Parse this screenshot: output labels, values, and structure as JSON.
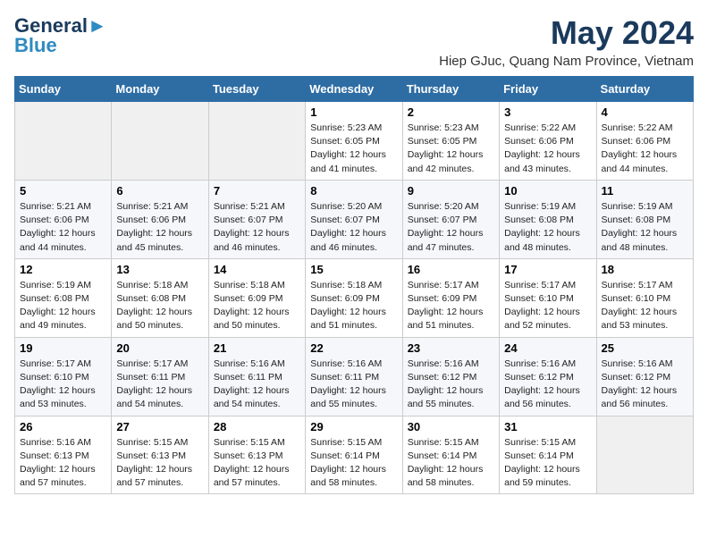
{
  "logo": {
    "general": "General",
    "blue": "Blue"
  },
  "header": {
    "month_year": "May 2024",
    "location": "Hiep GJuc, Quang Nam Province, Vietnam"
  },
  "days_of_week": [
    "Sunday",
    "Monday",
    "Tuesday",
    "Wednesday",
    "Thursday",
    "Friday",
    "Saturday"
  ],
  "weeks": [
    {
      "days": [
        {
          "num": "",
          "info": ""
        },
        {
          "num": "",
          "info": ""
        },
        {
          "num": "",
          "info": ""
        },
        {
          "num": "1",
          "info": "Sunrise: 5:23 AM\nSunset: 6:05 PM\nDaylight: 12 hours\nand 41 minutes."
        },
        {
          "num": "2",
          "info": "Sunrise: 5:23 AM\nSunset: 6:05 PM\nDaylight: 12 hours\nand 42 minutes."
        },
        {
          "num": "3",
          "info": "Sunrise: 5:22 AM\nSunset: 6:06 PM\nDaylight: 12 hours\nand 43 minutes."
        },
        {
          "num": "4",
          "info": "Sunrise: 5:22 AM\nSunset: 6:06 PM\nDaylight: 12 hours\nand 44 minutes."
        }
      ]
    },
    {
      "days": [
        {
          "num": "5",
          "info": "Sunrise: 5:21 AM\nSunset: 6:06 PM\nDaylight: 12 hours\nand 44 minutes."
        },
        {
          "num": "6",
          "info": "Sunrise: 5:21 AM\nSunset: 6:06 PM\nDaylight: 12 hours\nand 45 minutes."
        },
        {
          "num": "7",
          "info": "Sunrise: 5:21 AM\nSunset: 6:07 PM\nDaylight: 12 hours\nand 46 minutes."
        },
        {
          "num": "8",
          "info": "Sunrise: 5:20 AM\nSunset: 6:07 PM\nDaylight: 12 hours\nand 46 minutes."
        },
        {
          "num": "9",
          "info": "Sunrise: 5:20 AM\nSunset: 6:07 PM\nDaylight: 12 hours\nand 47 minutes."
        },
        {
          "num": "10",
          "info": "Sunrise: 5:19 AM\nSunset: 6:08 PM\nDaylight: 12 hours\nand 48 minutes."
        },
        {
          "num": "11",
          "info": "Sunrise: 5:19 AM\nSunset: 6:08 PM\nDaylight: 12 hours\nand 48 minutes."
        }
      ]
    },
    {
      "days": [
        {
          "num": "12",
          "info": "Sunrise: 5:19 AM\nSunset: 6:08 PM\nDaylight: 12 hours\nand 49 minutes."
        },
        {
          "num": "13",
          "info": "Sunrise: 5:18 AM\nSunset: 6:08 PM\nDaylight: 12 hours\nand 50 minutes."
        },
        {
          "num": "14",
          "info": "Sunrise: 5:18 AM\nSunset: 6:09 PM\nDaylight: 12 hours\nand 50 minutes."
        },
        {
          "num": "15",
          "info": "Sunrise: 5:18 AM\nSunset: 6:09 PM\nDaylight: 12 hours\nand 51 minutes."
        },
        {
          "num": "16",
          "info": "Sunrise: 5:17 AM\nSunset: 6:09 PM\nDaylight: 12 hours\nand 51 minutes."
        },
        {
          "num": "17",
          "info": "Sunrise: 5:17 AM\nSunset: 6:10 PM\nDaylight: 12 hours\nand 52 minutes."
        },
        {
          "num": "18",
          "info": "Sunrise: 5:17 AM\nSunset: 6:10 PM\nDaylight: 12 hours\nand 53 minutes."
        }
      ]
    },
    {
      "days": [
        {
          "num": "19",
          "info": "Sunrise: 5:17 AM\nSunset: 6:10 PM\nDaylight: 12 hours\nand 53 minutes."
        },
        {
          "num": "20",
          "info": "Sunrise: 5:17 AM\nSunset: 6:11 PM\nDaylight: 12 hours\nand 54 minutes."
        },
        {
          "num": "21",
          "info": "Sunrise: 5:16 AM\nSunset: 6:11 PM\nDaylight: 12 hours\nand 54 minutes."
        },
        {
          "num": "22",
          "info": "Sunrise: 5:16 AM\nSunset: 6:11 PM\nDaylight: 12 hours\nand 55 minutes."
        },
        {
          "num": "23",
          "info": "Sunrise: 5:16 AM\nSunset: 6:12 PM\nDaylight: 12 hours\nand 55 minutes."
        },
        {
          "num": "24",
          "info": "Sunrise: 5:16 AM\nSunset: 6:12 PM\nDaylight: 12 hours\nand 56 minutes."
        },
        {
          "num": "25",
          "info": "Sunrise: 5:16 AM\nSunset: 6:12 PM\nDaylight: 12 hours\nand 56 minutes."
        }
      ]
    },
    {
      "days": [
        {
          "num": "26",
          "info": "Sunrise: 5:16 AM\nSunset: 6:13 PM\nDaylight: 12 hours\nand 57 minutes."
        },
        {
          "num": "27",
          "info": "Sunrise: 5:15 AM\nSunset: 6:13 PM\nDaylight: 12 hours\nand 57 minutes."
        },
        {
          "num": "28",
          "info": "Sunrise: 5:15 AM\nSunset: 6:13 PM\nDaylight: 12 hours\nand 57 minutes."
        },
        {
          "num": "29",
          "info": "Sunrise: 5:15 AM\nSunset: 6:14 PM\nDaylight: 12 hours\nand 58 minutes."
        },
        {
          "num": "30",
          "info": "Sunrise: 5:15 AM\nSunset: 6:14 PM\nDaylight: 12 hours\nand 58 minutes."
        },
        {
          "num": "31",
          "info": "Sunrise: 5:15 AM\nSunset: 6:14 PM\nDaylight: 12 hours\nand 59 minutes."
        },
        {
          "num": "",
          "info": ""
        }
      ]
    }
  ]
}
